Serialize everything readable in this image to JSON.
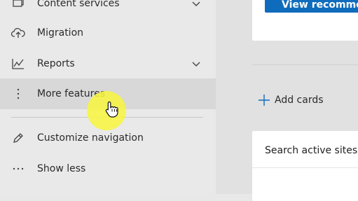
{
  "sidebar": {
    "items": [
      {
        "label": "Content services",
        "icon": "content-services-icon",
        "has_chevron": true
      },
      {
        "label": "Migration",
        "icon": "cloud-upload-icon",
        "has_chevron": false
      },
      {
        "label": "Reports",
        "icon": "chart-line-icon",
        "has_chevron": true
      },
      {
        "label": "More features",
        "icon": "more-vertical-icon",
        "has_chevron": false,
        "selected": true
      },
      {
        "label": "Customize navigation",
        "icon": "pencil-icon",
        "has_chevron": false
      },
      {
        "label": "Show less",
        "icon": "more-horizontal-icon",
        "has_chevron": false
      }
    ]
  },
  "main": {
    "recommend_button_label": "View recommen",
    "add_cards_label": "Add cards",
    "card_title": "Search active sites"
  },
  "colors": {
    "accent": "#0f6cbd",
    "cursor_highlight": "#f8f63c"
  }
}
